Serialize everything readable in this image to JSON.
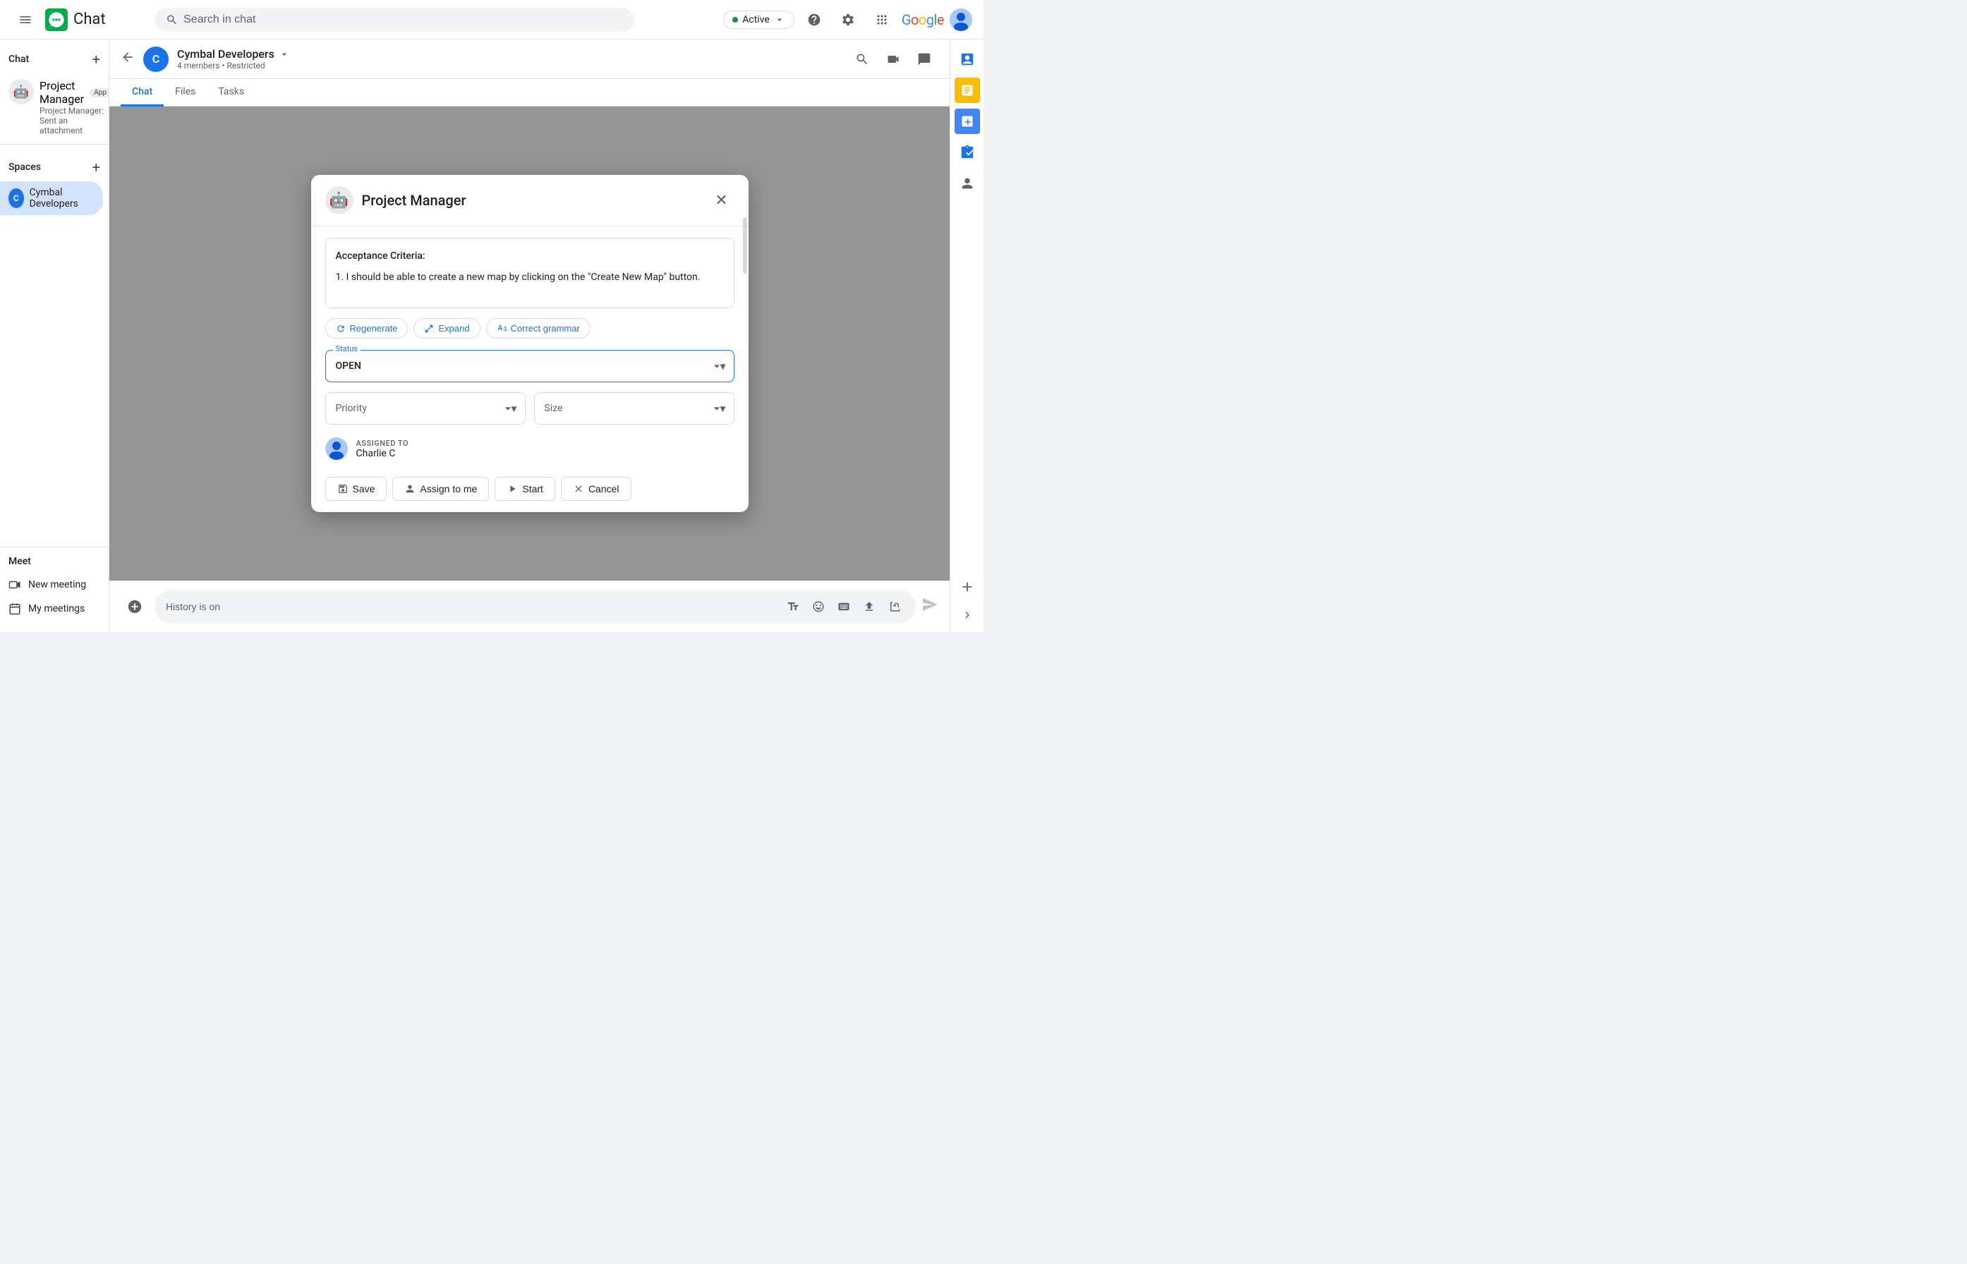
{
  "topbar": {
    "search_placeholder": "Search in chat",
    "status_label": "Active",
    "app_title": "Chat"
  },
  "sidebar": {
    "chat_section": "Chat",
    "pm_item": {
      "name": "Project Manager",
      "badge": "App",
      "sub": "Project Manager: Sent an attachment"
    },
    "spaces_section": "Spaces",
    "spaces_plus": "+",
    "space_item": {
      "initial": "C",
      "name": "Cymbal Developers"
    },
    "meet_section": "Meet",
    "new_meeting": "New meeting",
    "my_meetings": "My meetings"
  },
  "chat_header": {
    "space_initial": "C",
    "space_name": "Cymbal Developers",
    "space_meta": "4 members • Restricted",
    "tabs": [
      "Chat",
      "Files",
      "Tasks"
    ]
  },
  "chat_input": {
    "placeholder": "History is on"
  },
  "modal": {
    "title": "Project Manager",
    "bot_emoji": "🤖",
    "acceptance_criteria_label": "Acceptance Criteria:",
    "acceptance_criteria_text": "1. I should be able to create a new map by clicking on the \"Create New Map\" button.",
    "regenerate_btn": "Regenerate",
    "expand_btn": "Expand",
    "correct_grammar_btn": "Correct grammar",
    "status_label": "Status",
    "status_value": "OPEN",
    "priority_label": "Priority",
    "size_label": "Size",
    "assigned_to_label": "ASSIGNED TO",
    "assigned_name": "Charlie C",
    "save_btn": "Save",
    "assign_to_me_btn": "Assign to me",
    "start_btn": "Start",
    "cancel_btn": "Cancel"
  },
  "right_panel": {
    "icons": [
      "task-icon",
      "person-icon",
      "add-icon"
    ]
  }
}
